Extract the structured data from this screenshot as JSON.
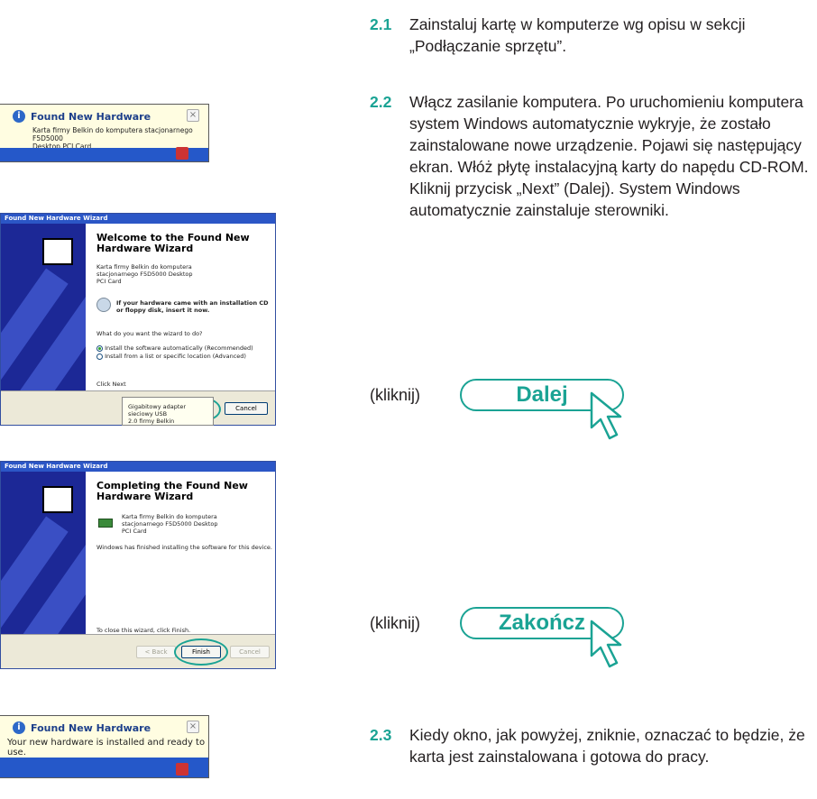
{
  "steps": {
    "s21": {
      "num": "2.1",
      "text": "Zainstaluj kartę w komputerze wg opisu w sekcji „Podłączanie sprzętu”."
    },
    "s22": {
      "num": "2.2",
      "text": "Włącz zasilanie komputera. Po uruchomieniu komputera system Windows automatycznie wykryje, że zostało zainstalowane nowe urządzenie. Pojawi się następujący ekran. Włóż płytę instalacyjną karty do napędu CD-ROM. Kliknij przycisk „Next” (Dalej). System Windows automatycznie zainstaluje sterowniki."
    },
    "s23": {
      "num": "2.3",
      "text": "Kiedy okno, jak powyżej, zniknie, oznaczać to będzie, że karta jest zainstalowana i gotowa do pracy."
    }
  },
  "click_next": {
    "label": "(kliknij)",
    "button": "Dalej"
  },
  "click_finish": {
    "label": "(kliknij)",
    "button": "Zakończ"
  },
  "balloon1": {
    "title": "Found New Hardware",
    "body_line1": "Karta firmy Belkin do komputera stacjonarnego F5D5000",
    "body_line2": "Desktop PCI Card",
    "close": "×"
  },
  "wizard1": {
    "window_title": "Found New Hardware Wizard",
    "heading_line1": "Welcome to the Found New",
    "heading_line2": "Hardware Wizard",
    "device_line1": "Karta firmy Belkin do komputera",
    "device_line2": "stacjonarnego F5D5000 Desktop",
    "device_line3": "PCI Card",
    "cd_line1": "If your hardware came with an installation CD",
    "cd_line2": "or floppy disk, insert it now.",
    "question": "What do you want the wizard to do?",
    "option1": "Install the software automatically (Recommended)",
    "option2": "Install from a list or specific location (Advanced)",
    "click_next": "Click Next",
    "cancel": "Cancel"
  },
  "tooltip": {
    "line1": "Gigabitowy adapter sieciowy USB",
    "line2": "2.0 firmy Belkin"
  },
  "wizard2": {
    "window_title": "Found New Hardware Wizard",
    "heading_line1": "Completing the Found New",
    "heading_line2": "Hardware Wizard",
    "device_line1": "Karta firmy Belkin do komputera",
    "device_line2": "stacjonarnego F5D5000 Desktop",
    "device_line3": "PCI Card",
    "finished": "Windows has finished installing the software for this device.",
    "close_text": "To close this wizard, click Finish.",
    "back": "< Back",
    "finish": "Finish",
    "cancel": "Cancel"
  },
  "balloon2": {
    "title": "Found New Hardware",
    "body": "Your new hardware is installed and ready to use.",
    "close": "×"
  },
  "colors": {
    "accent": "#1aa394",
    "text": "#231f20",
    "xp_blue": "#2b56c6"
  }
}
